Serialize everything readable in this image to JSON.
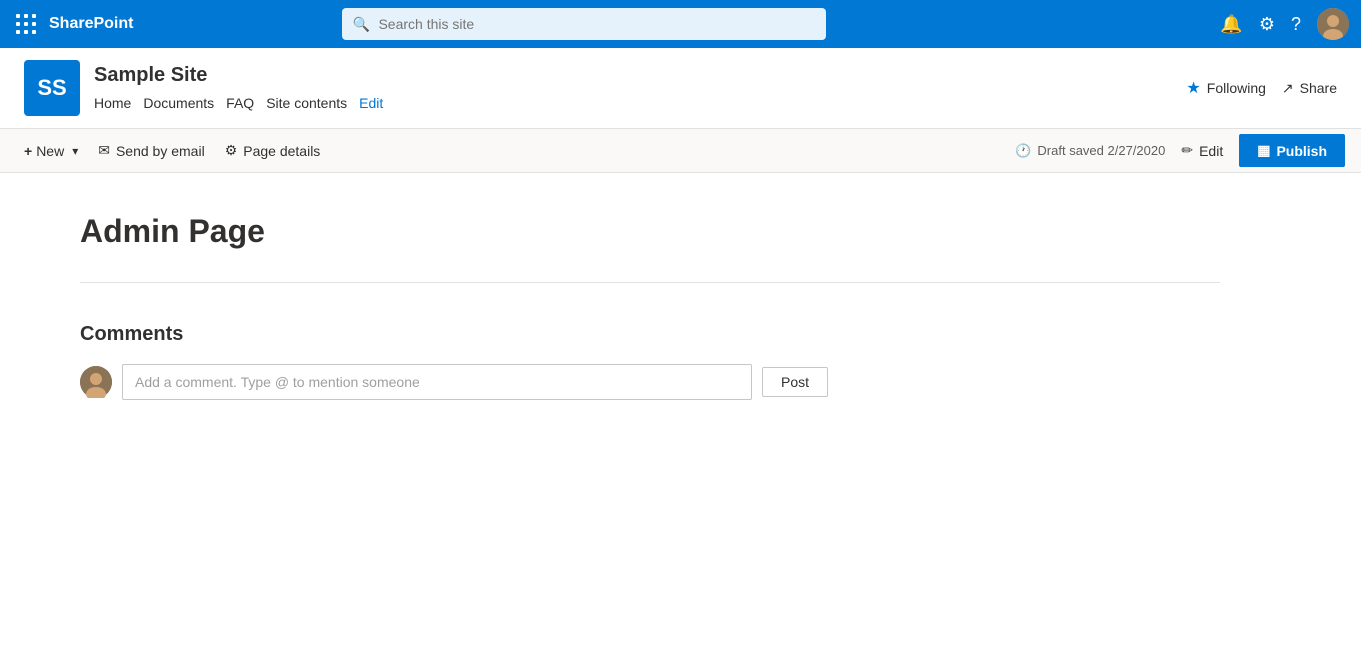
{
  "topnav": {
    "app_name": "SharePoint",
    "search_placeholder": "Search this site",
    "notification_icon": "🔔",
    "settings_icon": "⚙",
    "help_icon": "?"
  },
  "site_header": {
    "logo_initials": "SS",
    "site_name": "Sample Site",
    "nav_items": [
      {
        "label": "Home",
        "active": false
      },
      {
        "label": "Documents",
        "active": false
      },
      {
        "label": "FAQ",
        "active": false
      },
      {
        "label": "Site contents",
        "active": false
      },
      {
        "label": "Edit",
        "active": true
      }
    ],
    "following_label": "Following",
    "share_label": "Share"
  },
  "toolbar": {
    "new_label": "New",
    "send_email_label": "Send by email",
    "page_details_label": "Page details",
    "draft_saved_label": "Draft saved 2/27/2020",
    "edit_label": "Edit",
    "publish_label": "Publish"
  },
  "page": {
    "title": "Admin Page",
    "comments_heading": "Comments",
    "comment_placeholder": "Add a comment. Type @ to mention someone",
    "post_button_label": "Post"
  }
}
